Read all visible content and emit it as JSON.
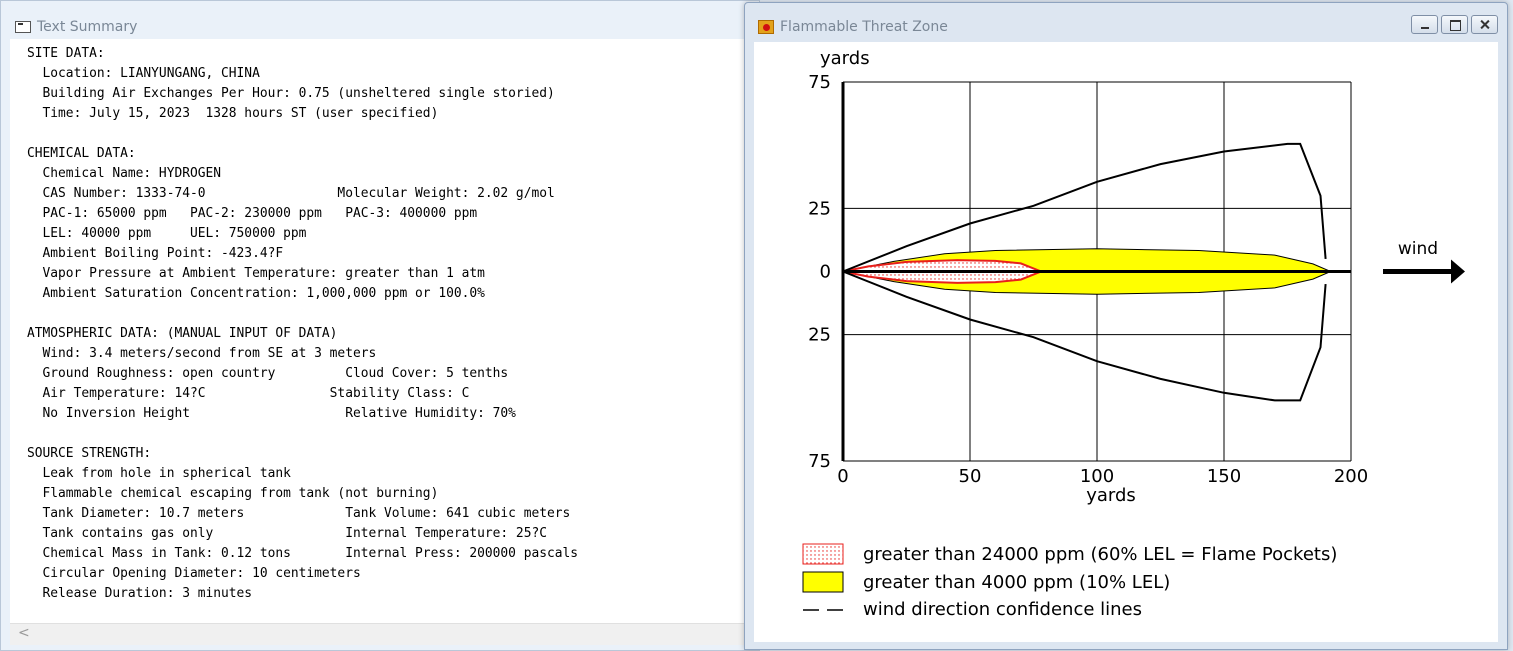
{
  "text_summary": {
    "title": "Text Summary",
    "lines": [
      "SITE DATA:",
      "  Location: LIANYUNGANG, CHINA",
      "  Building Air Exchanges Per Hour: 0.75 (unsheltered single storied)",
      "  Time: July 15, 2023  1328 hours ST (user specified)",
      "",
      "CHEMICAL DATA:",
      "  Chemical Name: HYDROGEN",
      "  CAS Number: 1333-74-0                 Molecular Weight: 2.02 g/mol",
      "  PAC-1: 65000 ppm   PAC-2: 230000 ppm   PAC-3: 400000 ppm",
      "  LEL: 40000 ppm     UEL: 750000 ppm",
      "  Ambient Boiling Point: -423.4?F",
      "  Vapor Pressure at Ambient Temperature: greater than 1 atm",
      "  Ambient Saturation Concentration: 1,000,000 ppm or 100.0%",
      "",
      "ATMOSPHERIC DATA: (MANUAL INPUT OF DATA)",
      "  Wind: 3.4 meters/second from SE at 3 meters",
      "  Ground Roughness: open country         Cloud Cover: 5 tenths",
      "  Air Temperature: 14?C                Stability Class: C",
      "  No Inversion Height                    Relative Humidity: 70%",
      "",
      "SOURCE STRENGTH:",
      "  Leak from hole in spherical tank",
      "  Flammable chemical escaping from tank (not burning)",
      "  Tank Diameter: 10.7 meters             Tank Volume: 641 cubic meters",
      "  Tank contains gas only                 Internal Temperature: 25?C",
      "  Chemical Mass in Tank: 0.12 tons       Internal Press: 200000 pascals",
      "  Circular Opening Diameter: 10 centimeters",
      "  Release Duration: 3 minutes"
    ],
    "scroll_left_glyph": "<"
  },
  "threat_zone": {
    "title": "Flammable Threat Zone",
    "window_buttons": [
      "minimize",
      "maximize",
      "close"
    ]
  },
  "chart_data": {
    "type": "area",
    "title": "",
    "xlabel": "yards",
    "ylabel": "yards",
    "xlim": [
      0,
      200
    ],
    "ylim": [
      -75,
      75
    ],
    "x_ticks": [
      "0",
      "50",
      "100",
      "150",
      "200"
    ],
    "y_ticks": [
      {
        "value": 75,
        "label": "75"
      },
      {
        "value": 25,
        "label": "25"
      },
      {
        "value": 0,
        "label": "0"
      },
      {
        "value": -25,
        "label": "25"
      },
      {
        "value": -75,
        "label": "75"
      }
    ],
    "grid": true,
    "wind_label": "wind",
    "series": [
      {
        "name": "greater than 24000 ppm (60% LEL = Flame Pockets)",
        "color": "#e8201c",
        "fill": "pink-dotted",
        "outline_upper": [
          [
            0,
            0
          ],
          [
            10,
            2
          ],
          [
            25,
            3.8
          ],
          [
            45,
            4.5
          ],
          [
            60,
            4.2
          ],
          [
            70,
            3.2
          ],
          [
            78,
            0
          ]
        ],
        "outline_lower": [
          [
            0,
            0
          ],
          [
            10,
            -2
          ],
          [
            25,
            -3.8
          ],
          [
            45,
            -4.5
          ],
          [
            60,
            -4.2
          ],
          [
            70,
            -3.2
          ],
          [
            78,
            0
          ]
        ]
      },
      {
        "name": "greater than 4000 ppm (10% LEL)",
        "color": "#ffff00",
        "fill": "solid",
        "outline_upper": [
          [
            0,
            0
          ],
          [
            20,
            4
          ],
          [
            40,
            7
          ],
          [
            60,
            8.3
          ],
          [
            100,
            9
          ],
          [
            140,
            8.3
          ],
          [
            170,
            6.5
          ],
          [
            185,
            3
          ],
          [
            192,
            0
          ]
        ],
        "outline_lower": [
          [
            0,
            0
          ],
          [
            20,
            -4
          ],
          [
            40,
            -7
          ],
          [
            60,
            -8.3
          ],
          [
            100,
            -9
          ],
          [
            140,
            -8.3
          ],
          [
            170,
            -6.5
          ],
          [
            185,
            -3
          ],
          [
            192,
            0
          ]
        ]
      },
      {
        "name": "wind direction confidence lines",
        "color": "#000000",
        "fill": "none",
        "upper": [
          [
            0,
            0
          ],
          [
            25,
            10
          ],
          [
            50,
            19
          ],
          [
            75,
            26
          ],
          [
            100,
            35.5
          ],
          [
            125,
            42.5
          ],
          [
            150,
            47.5
          ],
          [
            175,
            50.5
          ],
          [
            180,
            50.5
          ],
          [
            188,
            30
          ],
          [
            190,
            5
          ]
        ],
        "lower": [
          [
            0,
            0
          ],
          [
            25,
            -10
          ],
          [
            50,
            -19
          ],
          [
            75,
            -26
          ],
          [
            100,
            -35.5
          ],
          [
            125,
            -42.5
          ],
          [
            150,
            -48
          ],
          [
            170,
            -51
          ],
          [
            180,
            -51
          ],
          [
            188,
            -30
          ],
          [
            190,
            -5
          ]
        ]
      }
    ],
    "legend_position": "bottom-left"
  }
}
